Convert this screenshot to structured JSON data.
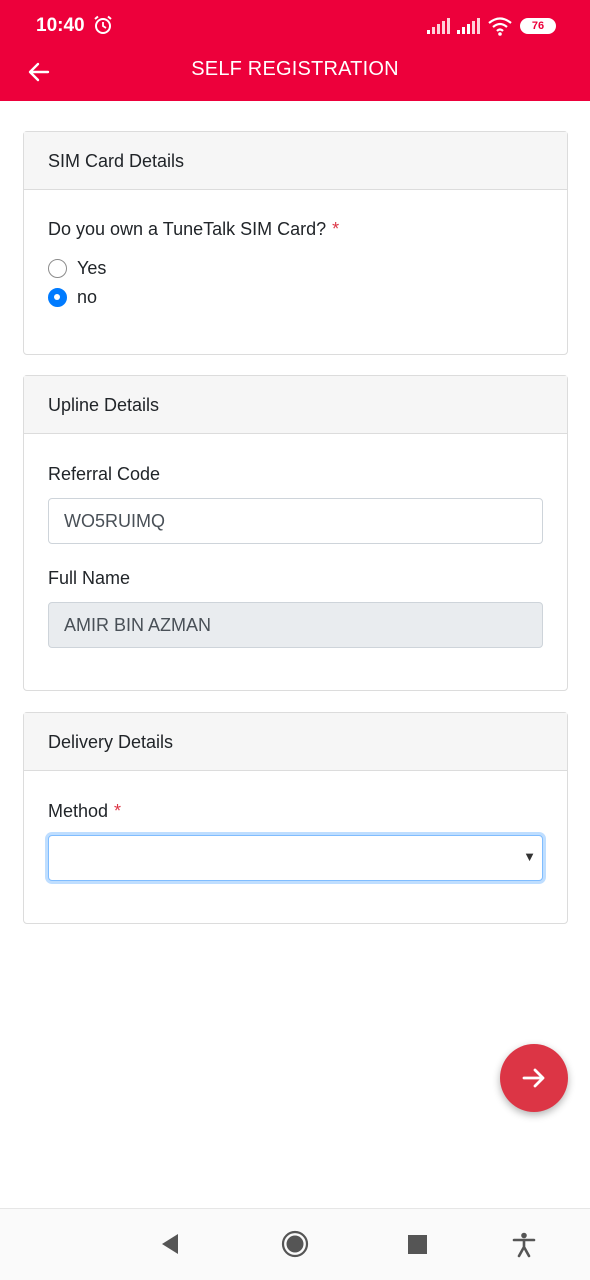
{
  "status_bar": {
    "time": "10:40",
    "battery": "76"
  },
  "header": {
    "title": "SELF REGISTRATION"
  },
  "sim_card": {
    "section_title": "SIM Card Details",
    "question": "Do you own a TuneTalk SIM Card?",
    "required_mark": "*",
    "options": [
      {
        "label": "Yes",
        "checked": false
      },
      {
        "label": "no",
        "checked": true
      }
    ]
  },
  "upline": {
    "section_title": "Upline Details",
    "referral_label": "Referral Code",
    "referral_value": "WO5RUIMQ",
    "fullname_label": "Full Name",
    "fullname_value": "AMIR BIN AZMAN"
  },
  "delivery": {
    "section_title": "Delivery Details",
    "method_label": "Method",
    "required_mark": "*",
    "method_value": ""
  },
  "colors": {
    "brand": "#ed003b",
    "fab": "#dc3545",
    "focus": "#007bff"
  },
  "icons": {
    "back": "arrow-left-icon",
    "next": "arrow-right-icon",
    "alarm": "alarm-clock-icon",
    "wifi": "wifi-icon",
    "signal": "signal-icon"
  }
}
